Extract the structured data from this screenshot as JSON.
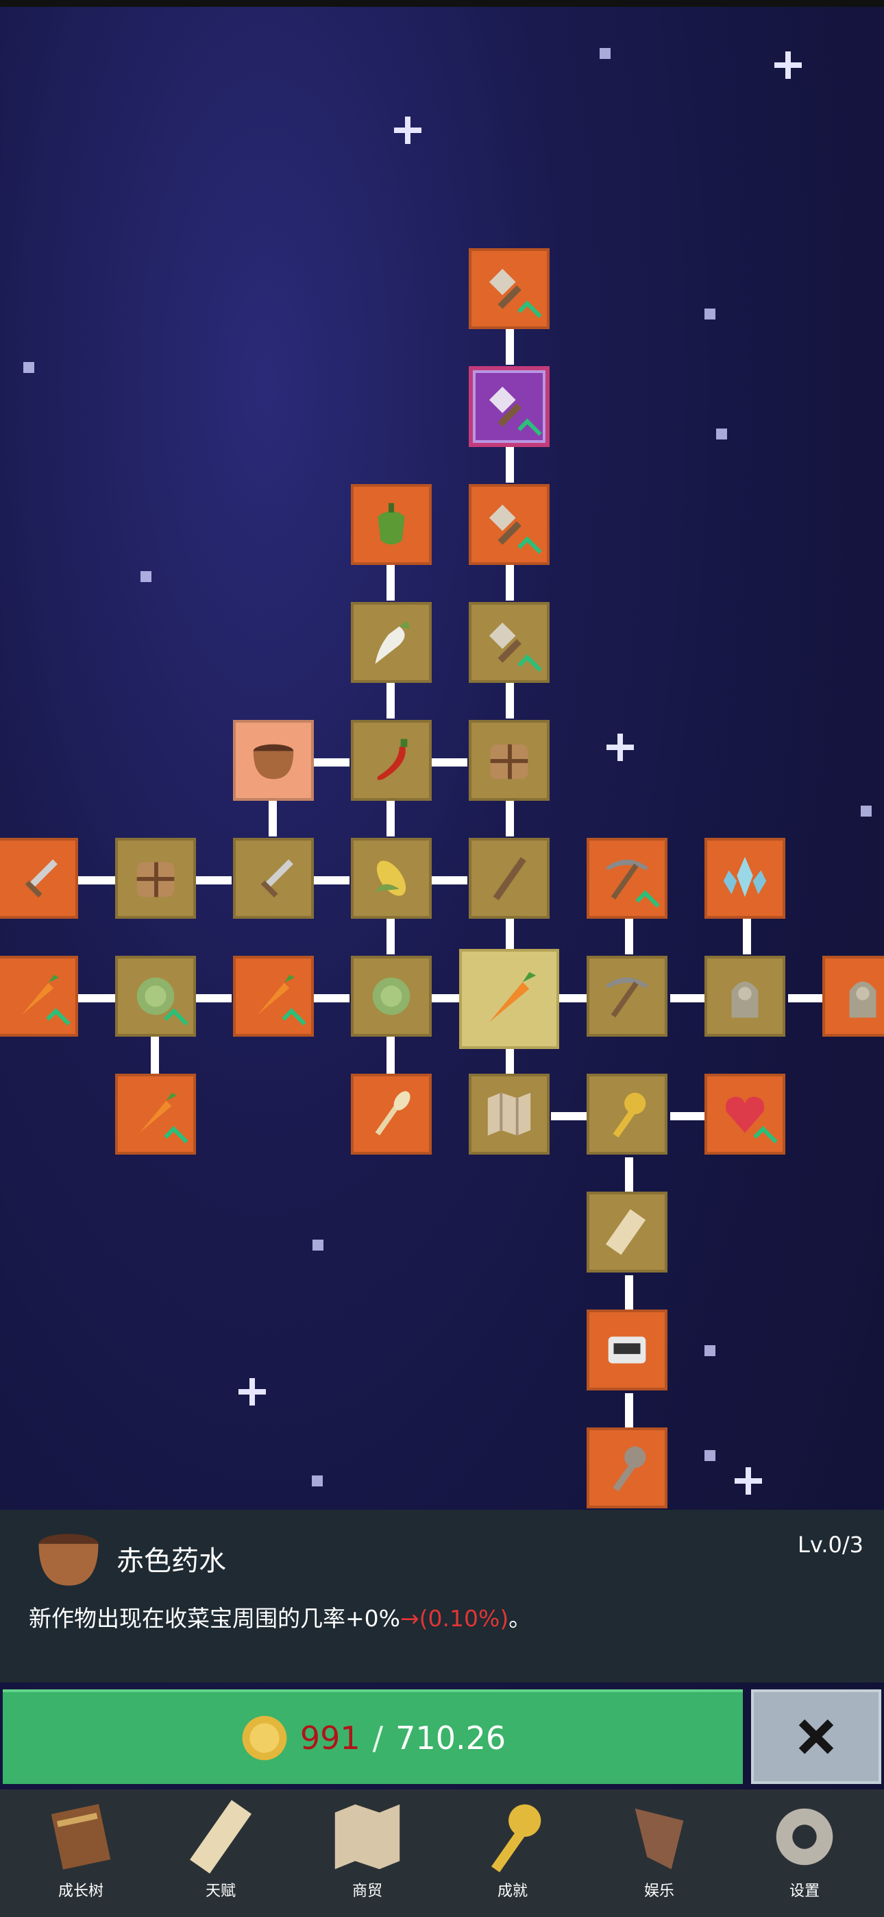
{
  "skill_panel": {
    "name": "赤色药水",
    "level": "Lv.0/3",
    "description_prefix": "新作物出现在收菜宝周围的几率+0%",
    "description_arrow": "→",
    "description_value": "(0.10%)",
    "description_suffix": "。"
  },
  "purchase": {
    "current": "991",
    "separator": "/",
    "cost": "710.26"
  },
  "nav": {
    "tabs": [
      {
        "label": "成长树",
        "icon": "book-icon"
      },
      {
        "label": "天赋",
        "icon": "scroll-icon"
      },
      {
        "label": "商贸",
        "icon": "map-icon"
      },
      {
        "label": "成就",
        "icon": "key-icon"
      },
      {
        "label": "娱乐",
        "icon": "flag-icon"
      },
      {
        "label": "设置",
        "icon": "gear-icon"
      }
    ]
  },
  "colors": {
    "node_orange": "#e0662a",
    "node_brown": "#a78a43",
    "buy_green": "#3bb36a",
    "panel_bg": "#1f2a32",
    "nav_bg": "#2a3136"
  },
  "tree_nodes": [
    {
      "id": "shovel-top",
      "icon": "shovel-icon",
      "style": "orange"
    },
    {
      "id": "shovel-purple",
      "icon": "shovel-icon",
      "style": "purple"
    },
    {
      "id": "shovel-3",
      "icon": "shovel-icon",
      "style": "orange"
    },
    {
      "id": "shovel-4",
      "icon": "shovel-icon",
      "style": "brown"
    },
    {
      "id": "pepper",
      "icon": "pepper-icon",
      "style": "orange"
    },
    {
      "id": "radish",
      "icon": "radish-icon",
      "style": "brown"
    },
    {
      "id": "pot",
      "icon": "pot-icon",
      "style": "burst"
    },
    {
      "id": "chili",
      "icon": "chili-icon",
      "style": "brown"
    },
    {
      "id": "bag-1",
      "icon": "bag-icon",
      "style": "brown"
    },
    {
      "id": "sword-1",
      "icon": "sword-icon",
      "style": "orange"
    },
    {
      "id": "bag-2",
      "icon": "bag-icon",
      "style": "brown"
    },
    {
      "id": "sword-2",
      "icon": "sword-icon",
      "style": "brown"
    },
    {
      "id": "corn",
      "icon": "corn-icon",
      "style": "brown"
    },
    {
      "id": "stick",
      "icon": "stick-icon",
      "style": "brown"
    },
    {
      "id": "pickaxe-1",
      "icon": "pickaxe-icon",
      "style": "orange"
    },
    {
      "id": "crystal",
      "icon": "crystal-icon",
      "style": "orange"
    },
    {
      "id": "carrot-1",
      "icon": "carrot-icon",
      "style": "orange"
    },
    {
      "id": "cabbage-1",
      "icon": "cabbage-icon",
      "style": "brown"
    },
    {
      "id": "carrot-2",
      "icon": "carrot-icon",
      "style": "orange"
    },
    {
      "id": "cabbage-2",
      "icon": "cabbage-icon",
      "style": "brown"
    },
    {
      "id": "carrot-center",
      "icon": "carrot-icon",
      "style": "center"
    },
    {
      "id": "pickaxe-2",
      "icon": "pickaxe-icon",
      "style": "brown"
    },
    {
      "id": "statue-1",
      "icon": "statue-icon",
      "style": "brown"
    },
    {
      "id": "statue-2",
      "icon": "statue-icon",
      "style": "orange"
    },
    {
      "id": "carrot-3",
      "icon": "carrot-icon",
      "style": "orange"
    },
    {
      "id": "wheat",
      "icon": "wheat-icon",
      "style": "orange"
    },
    {
      "id": "map",
      "icon": "map-icon",
      "style": "brown"
    },
    {
      "id": "key-1",
      "icon": "key-icon",
      "style": "brown"
    },
    {
      "id": "heart",
      "icon": "heart-icon",
      "style": "orange"
    },
    {
      "id": "scroll",
      "icon": "scroll-icon",
      "style": "brown"
    },
    {
      "id": "tape",
      "icon": "tape-icon",
      "style": "orange"
    },
    {
      "id": "key-2",
      "icon": "key-icon",
      "style": "orange"
    }
  ]
}
